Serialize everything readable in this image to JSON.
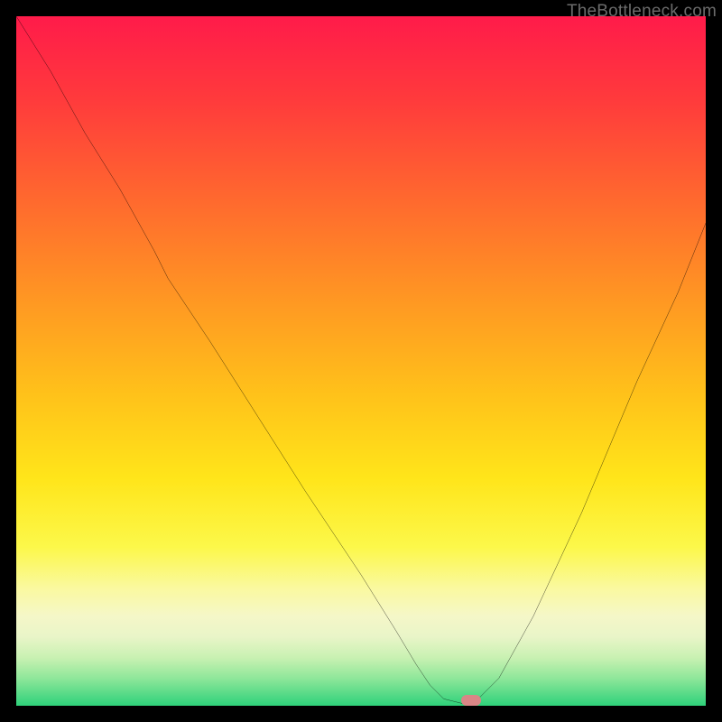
{
  "watermark": "TheBottleneck.com",
  "chart_data": {
    "type": "line",
    "title": "",
    "xlabel": "",
    "ylabel": "",
    "xlim": [
      0,
      100
    ],
    "ylim": [
      0,
      100
    ],
    "grid": false,
    "legend": false,
    "background": "heatmap-gradient red→yellow→green",
    "series": [
      {
        "name": "bottleneck-curve",
        "x": [
          0,
          5,
          10,
          15,
          20,
          22,
          28,
          35,
          42,
          50,
          55,
          58,
          60,
          62,
          66,
          70,
          75,
          82,
          90,
          96,
          100
        ],
        "y": [
          100,
          92,
          83,
          75,
          66,
          62,
          53,
          42,
          31,
          19,
          11,
          6,
          3,
          1,
          0,
          4,
          13,
          28,
          47,
          60,
          70
        ]
      }
    ],
    "marker": {
      "x": 66,
      "y": 0,
      "color": "#d98686",
      "shape": "pill"
    }
  },
  "colors": {
    "frame": "#000000",
    "gradient_top": "#ff1b4a",
    "gradient_mid": "#ffe51a",
    "gradient_bottom": "#2ed17a",
    "curve": "#000000"
  }
}
